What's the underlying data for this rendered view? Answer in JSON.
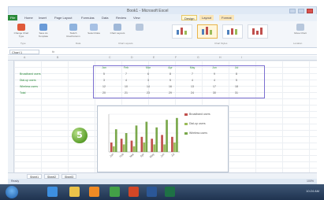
{
  "app": {
    "title": "Book1 - Microsoft Excel"
  },
  "ribbon_tabs": [
    "File",
    "Home",
    "Insert",
    "Page Layout",
    "Formulas",
    "Data",
    "Review",
    "View",
    "Design",
    "Layout",
    "Format"
  ],
  "ribbon": {
    "buttons": [
      {
        "label": "Change Chart Type",
        "icon": "chart-type-icon",
        "color": "#e05a3a"
      },
      {
        "label": "Save As Template",
        "icon": "save-template-icon",
        "color": "#6a9bd8"
      },
      {
        "label": "Switch Row/Column",
        "icon": "switch-row-column-icon",
        "color": "#8fb3de"
      },
      {
        "label": "Select Data",
        "icon": "select-data-icon",
        "color": "#a7c1e4"
      },
      {
        "label": "Chart Layouts",
        "icon": "chart-layouts-icon",
        "color": "#9fb8d8"
      },
      {
        "label": "Move Chart",
        "icon": "move-chart-icon",
        "color": "#b7c7dc"
      }
    ],
    "groups": [
      "Type",
      "Data",
      "Chart Layouts",
      "Chart Styles",
      "Location"
    ],
    "styles_count": 4
  },
  "formula_bar": {
    "name_box": "Chart 1",
    "fx": "fx"
  },
  "columns": [
    "A",
    "B",
    "C",
    "D",
    "E",
    "F",
    "G",
    "H",
    "I"
  ],
  "table": {
    "headers": [
      "Jan",
      "Feb",
      "Mar",
      "Apr",
      "May",
      "Jun",
      "Jul"
    ],
    "rows": [
      {
        "label": "Broadband users",
        "values": [
          "5",
          "7",
          "6",
          "8",
          "7",
          "9",
          "8"
        ]
      },
      {
        "label": "Dial-up users",
        "values": [
          "3",
          "4",
          "3",
          "5",
          "4",
          "4",
          "5"
        ]
      },
      {
        "label": "Wireless users",
        "values": [
          "12",
          "10",
          "14",
          "16",
          "13",
          "17",
          "18"
        ]
      },
      {
        "label": "Total",
        "values": [
          "20",
          "21",
          "23",
          "29",
          "24",
          "30",
          "31"
        ]
      }
    ]
  },
  "step_badge": "5",
  "chart_data": {
    "type": "bar",
    "categories": [
      "Jan",
      "Feb",
      "Mar",
      "Apr",
      "May",
      "Jun",
      "Jul"
    ],
    "series": [
      {
        "name": "Broadband users",
        "values": [
          5,
          7,
          6,
          8,
          7,
          9,
          8
        ],
        "color": "#c0504d"
      },
      {
        "name": "Dial-up users",
        "values": [
          3,
          4,
          3,
          5,
          4,
          4,
          5
        ],
        "color": "#9bbb59"
      },
      {
        "name": "Wireless users",
        "values": [
          12,
          10,
          14,
          16,
          13,
          17,
          18
        ],
        "color": "#7aa84c"
      }
    ],
    "ylim": [
      0,
      20
    ],
    "grid": true,
    "legend": "right"
  },
  "sheet_tabs": [
    "Sheet1",
    "Sheet2",
    "Sheet3"
  ],
  "status": {
    "ready": "Ready",
    "zoom": "100%"
  },
  "taskbar": {
    "icons": [
      {
        "name": "ie-icon",
        "color": "#3d8fe0"
      },
      {
        "name": "explorer-icon",
        "color": "#e9c24a"
      },
      {
        "name": "media-player-icon",
        "color": "#f08a24"
      },
      {
        "name": "chrome-icon",
        "color": "#43a047"
      },
      {
        "name": "powerpoint-icon",
        "color": "#d24726"
      },
      {
        "name": "word-icon",
        "color": "#2b5797"
      },
      {
        "name": "excel-icon",
        "color": "#1e7145"
      }
    ],
    "clock": "10:24 AM"
  }
}
